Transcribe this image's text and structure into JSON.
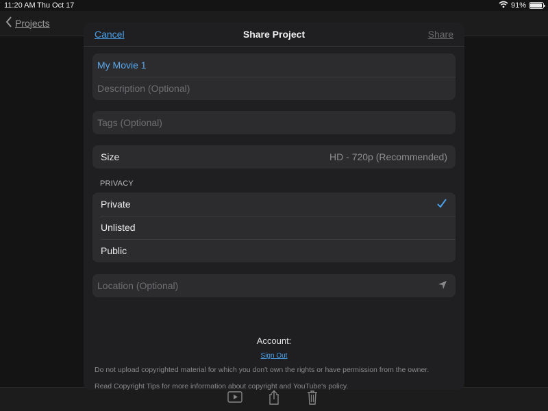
{
  "status_bar": {
    "time": "11:20 AM",
    "date": "Thu Oct 17",
    "battery": "91%"
  },
  "background": {
    "back_label": "Projects"
  },
  "sheet": {
    "cancel_label": "Cancel",
    "title": "Share Project",
    "share_label": "Share",
    "movie_title": "My Movie 1",
    "description_placeholder": "Description (Optional)",
    "tags_placeholder": "Tags (Optional)",
    "size_label": "Size",
    "size_value": "HD - 720p (Recommended)",
    "privacy_header": "PRIVACY",
    "privacy_options": [
      "Private",
      "Unlisted",
      "Public"
    ],
    "privacy_selected": "Private",
    "location_placeholder": "Location (Optional)",
    "account_label": "Account:",
    "sign_out_label": "Sign Out",
    "notice_1": "Do not upload copyrighted material for which you don't own the rights or have permission from the owner.",
    "notice_2": "Read Copyright Tips for more information about copyright and YouTube's policy."
  },
  "colors": {
    "accent": "#4aa0ea",
    "sheet_bg": "#1f1f21",
    "group_bg": "#2c2c2e"
  },
  "icons": [
    "wifi-icon",
    "battery-icon",
    "chevron-left-icon",
    "checkmark-icon",
    "location-arrow-icon",
    "play-icon",
    "share-icon",
    "trash-icon"
  ]
}
